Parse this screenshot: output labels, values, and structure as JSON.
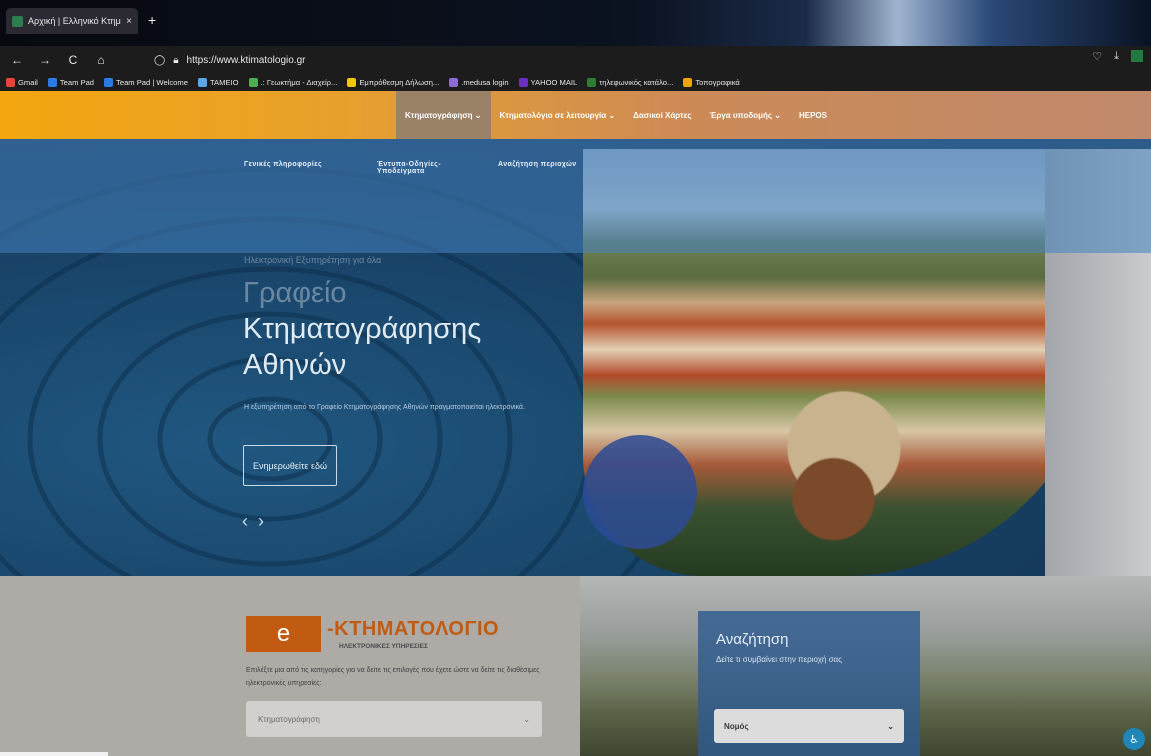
{
  "browser": {
    "tab_title": "Αρχική | Ελληνικό Κτηματολόγι",
    "tab_close": "×",
    "new_tab": "+",
    "url": "https://www.ktimatologio.gr",
    "nav_icons": [
      "arrow-back-icon",
      "arrow-forward-icon",
      "reload-icon",
      "home-icon"
    ],
    "right_icons": [
      "pocket-icon",
      "download-icon",
      "excel-icon"
    ]
  },
  "bookmarks": [
    {
      "label": "Gmail",
      "color": "#ea4335"
    },
    {
      "label": "Team Pad",
      "color": "#2c7be5"
    },
    {
      "label": "Team Pad | Welcome",
      "color": "#2c7be5"
    },
    {
      "label": "ΤΑΜΕΙΟ",
      "color": "#5aa9e6"
    },
    {
      "label": ".: Γεωκτήμα - Διαχείρ...",
      "color": "#4caf50"
    },
    {
      "label": "Εμπρόθεσμη Δήλωση...",
      "color": "#f2c500"
    },
    {
      "label": ".medusa login",
      "color": "#8e6bd8"
    },
    {
      "label": "YAHOO MAIL",
      "color": "#6b2fbf"
    },
    {
      "label": "τηλεφωνικός κατάλο...",
      "color": "#2e7d32"
    },
    {
      "label": "Τοπογραφικά",
      "color": "#f0a500"
    }
  ],
  "site": {
    "menu": [
      {
        "label": "Κτηματογράφηση ⌄",
        "active": true
      },
      {
        "label": "Κτηματολόγιο σε λειτουργία ⌄",
        "active": false
      },
      {
        "label": "Δασικοί Χάρτες",
        "active": false
      },
      {
        "label": "Έργα υποδομής ⌄",
        "active": false
      },
      {
        "label": "HEPOS",
        "active": false
      }
    ],
    "submenu": [
      "Γενικές πληροφορίες",
      "Έντυπα-Οδηγίες-Υποδείγματα",
      "Αναζήτηση περιοχών"
    ],
    "hero": {
      "eyebrow": "Ηλεκτρονική Εξυπηρέτηση για όλα",
      "title_line1": "Γραφείο",
      "title_line2": "Κτηματογράφησης",
      "title_line3": "Αθηνών",
      "description": "Η εξυπηρέτηση από το Γραφείο Κτηματογράφησης Αθηνών πραγματοποιείται ηλεκτρονικά.",
      "button": "Ενημερωθείτε εδώ",
      "prev": "‹",
      "next": "›"
    },
    "eservices": {
      "logo_letter": "e",
      "logo_main": "-ΚΤΗΜΑΤΟΛΟΓΙΟ",
      "logo_sub": "ΗΛΕΚΤΡΟΝΙΚΕΣ ΥΠΗΡΕΣΙΕΣ",
      "text": "Επιλέξτε μια από τις κατηγορίες για να δείτε τις επιλογές που έχετε ώστε να δείτε τις διαθέσιμες ηλεκτρονικές υπηρεσίες:",
      "select_value": "Κτηματογράφηση",
      "chevron": "⌄"
    },
    "search": {
      "title": "Αναζήτηση",
      "subtitle": "Δείτε τι συμβαίνει στην περιοχή σας",
      "select_value": "Νομός",
      "chevron": "⌄"
    }
  },
  "colors": {
    "brand_orange": "#c15b12",
    "nav_gradient_start": "#f3a60f",
    "hero_blue": "#173f63"
  }
}
